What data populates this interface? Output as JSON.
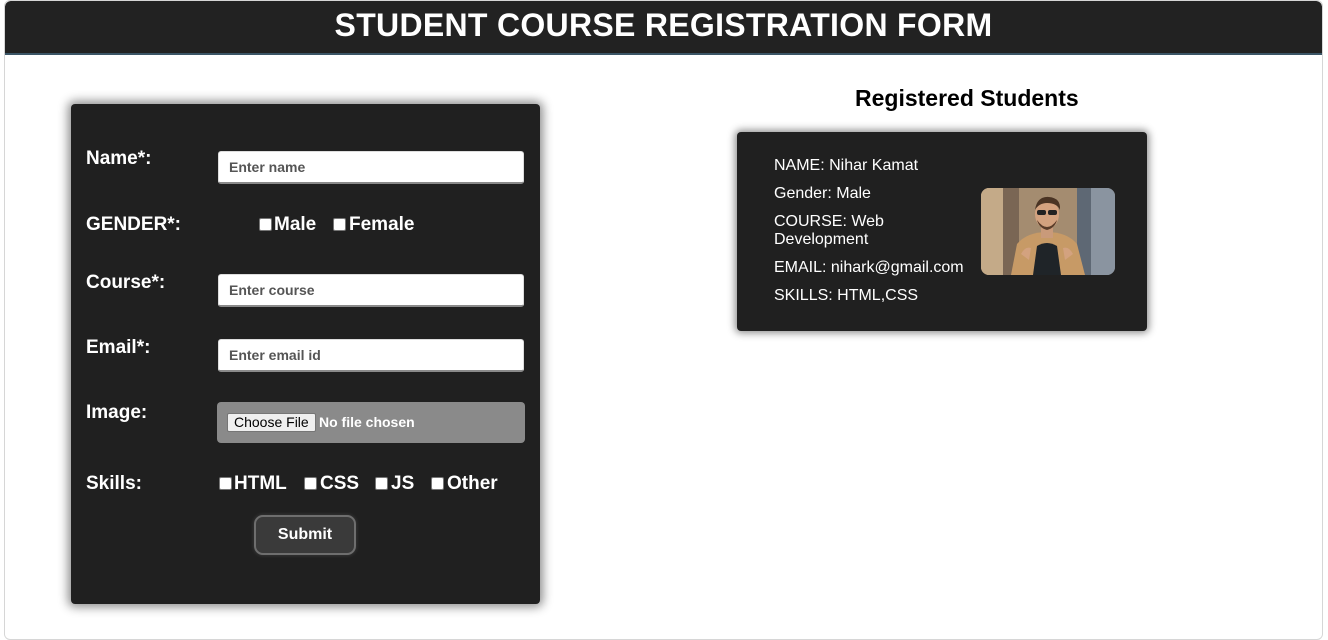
{
  "header": {
    "title": "STUDENT COURSE REGISTRATION FORM"
  },
  "form": {
    "name_label": "Name*:",
    "name_placeholder": "Enter name",
    "gender_label": "GENDER*:",
    "gender_options": [
      "Male",
      "Female"
    ],
    "course_label": "Course*:",
    "course_placeholder": "Enter course",
    "email_label": "Email*:",
    "email_placeholder": "Enter email id",
    "image_label": "Image:",
    "choose_file_label": "Choose File",
    "no_file_text": "No file chosen",
    "skills_label": "Skills:",
    "skills_options": [
      "HTML",
      "CSS",
      "JS",
      "Other"
    ],
    "submit_label": "Submit"
  },
  "students": {
    "title": "Registered Students",
    "cards": [
      {
        "name": "NAME: Nihar Kamat",
        "gender": "Gender: Male",
        "course": "COURSE: Web Development",
        "email": "EMAIL: nihark@gmail.com",
        "skills": "SKILLS: HTML,CSS"
      }
    ]
  },
  "colors": {
    "header_bg": "#222222",
    "panel_bg": "#202020",
    "file_box_bg": "#8a8a8a"
  }
}
